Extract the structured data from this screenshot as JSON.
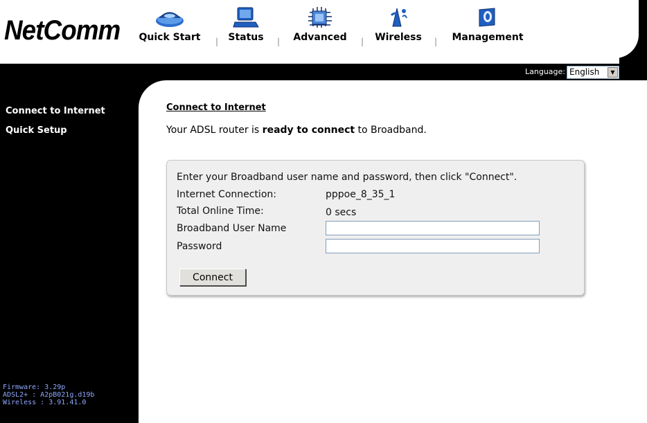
{
  "brand": {
    "logo_text": "NetComm"
  },
  "nav": {
    "items": [
      {
        "label": "Quick Start",
        "icon": "quick-start-icon"
      },
      {
        "label": "Status",
        "icon": "status-laptop-icon"
      },
      {
        "label": "Advanced",
        "icon": "advanced-chip-icon"
      },
      {
        "label": "Wireless",
        "icon": "wireless-icon"
      },
      {
        "label": "Management",
        "icon": "management-icon"
      }
    ],
    "separator": "|"
  },
  "language": {
    "label": "Language:",
    "selected": "English",
    "arrow": "▼"
  },
  "sidebar": {
    "items": [
      {
        "label": "Connect to Internet"
      },
      {
        "label": "Quick Setup"
      }
    ],
    "firmware": {
      "firmware": "Firmware: 3.29p",
      "adsl": "ADSL2+ : A2pB021g.d19b",
      "wireless": "Wireless : 3.91.41.0"
    }
  },
  "main": {
    "title": "Connect to Internet",
    "status_prefix": "Your ADSL router is ",
    "status_bold": "ready to connect",
    "status_suffix": " to Broadband."
  },
  "panel": {
    "instruction": "Enter your Broadband user name and password, then click \"Connect\".",
    "internet_connection_label": "Internet Connection:",
    "internet_connection_value": "pppoe_8_35_1",
    "online_time_label": "Total Online Time:",
    "online_time_value": "0 secs",
    "username_label": "Broadband User Name",
    "username_value": "",
    "password_label": "Password",
    "password_value": "",
    "connect_button": "Connect"
  },
  "colors": {
    "sidebar_bg": "#000000",
    "panel_bg": "#f0efef",
    "firmware_text": "#8fa8ff",
    "nav_icon_blue": "#1f5fbf"
  }
}
